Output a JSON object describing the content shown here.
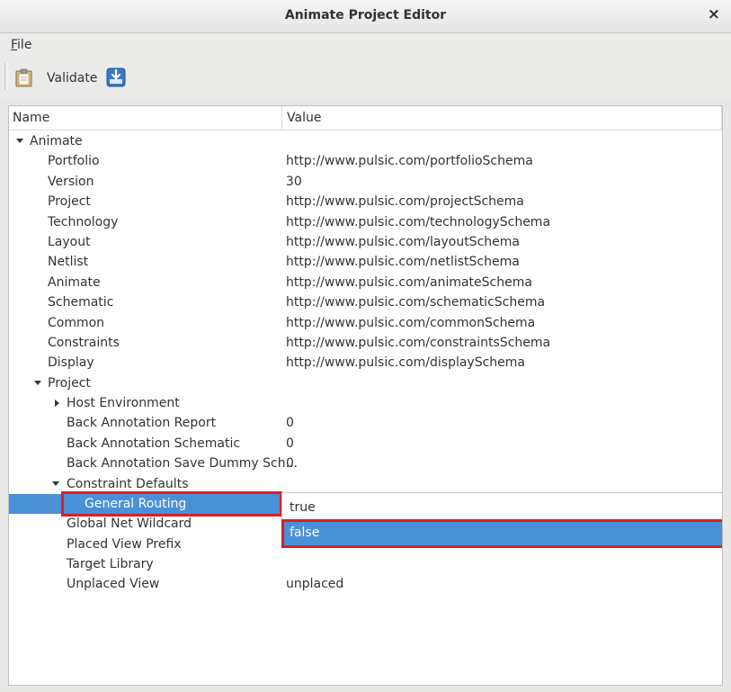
{
  "window": {
    "title": "Animate Project Editor",
    "close_glyph": "×"
  },
  "menubar": {
    "file_mnemonic": "F",
    "file_rest": "ile"
  },
  "toolbar": {
    "validate_label": "Validate",
    "validate_icon": "clipboard-icon",
    "download_icon": "download-icon"
  },
  "tree": {
    "columns": {
      "name": "Name",
      "value": "Value"
    },
    "rows": [
      {
        "name": "Animate",
        "value": ""
      },
      {
        "name": "Portfolio",
        "value": "http://www.pulsic.com/portfolioSchema"
      },
      {
        "name": "Version",
        "value": "30"
      },
      {
        "name": "Project",
        "value": "http://www.pulsic.com/projectSchema"
      },
      {
        "name": "Technology",
        "value": "http://www.pulsic.com/technologySchema"
      },
      {
        "name": "Layout",
        "value": "http://www.pulsic.com/layoutSchema"
      },
      {
        "name": "Netlist",
        "value": "http://www.pulsic.com/netlistSchema"
      },
      {
        "name": "Animate",
        "value": "http://www.pulsic.com/animateSchema"
      },
      {
        "name": "Schematic",
        "value": "http://www.pulsic.com/schematicSchema"
      },
      {
        "name": "Common",
        "value": "http://www.pulsic.com/commonSchema"
      },
      {
        "name": "Constraints",
        "value": "http://www.pulsic.com/constraintsSchema"
      },
      {
        "name": "Display",
        "value": "http://www.pulsic.com/displaySchema"
      },
      {
        "name": "Project",
        "value": ""
      },
      {
        "name": "Host Environment",
        "value": ""
      },
      {
        "name": "Back Annotation Report",
        "value": "0"
      },
      {
        "name": "Back Annotation Schematic",
        "value": "0"
      },
      {
        "name": "Back Annotation Save Dummy Sch...",
        "value": "0"
      },
      {
        "name": "Constraint Defaults",
        "value": ""
      },
      {
        "name": "General Routing",
        "value": ""
      },
      {
        "name": "Global Net Wildcard",
        "value": ""
      },
      {
        "name": "Placed View Prefix",
        "value": ""
      },
      {
        "name": "Target Library",
        "value": ""
      },
      {
        "name": "Unplaced View",
        "value": "unplaced"
      }
    ]
  },
  "combo_popup": {
    "options": [
      "true",
      "false"
    ],
    "selected": "false"
  },
  "colors": {
    "selection": "#4a90d9",
    "highlight": "#d91f26"
  }
}
